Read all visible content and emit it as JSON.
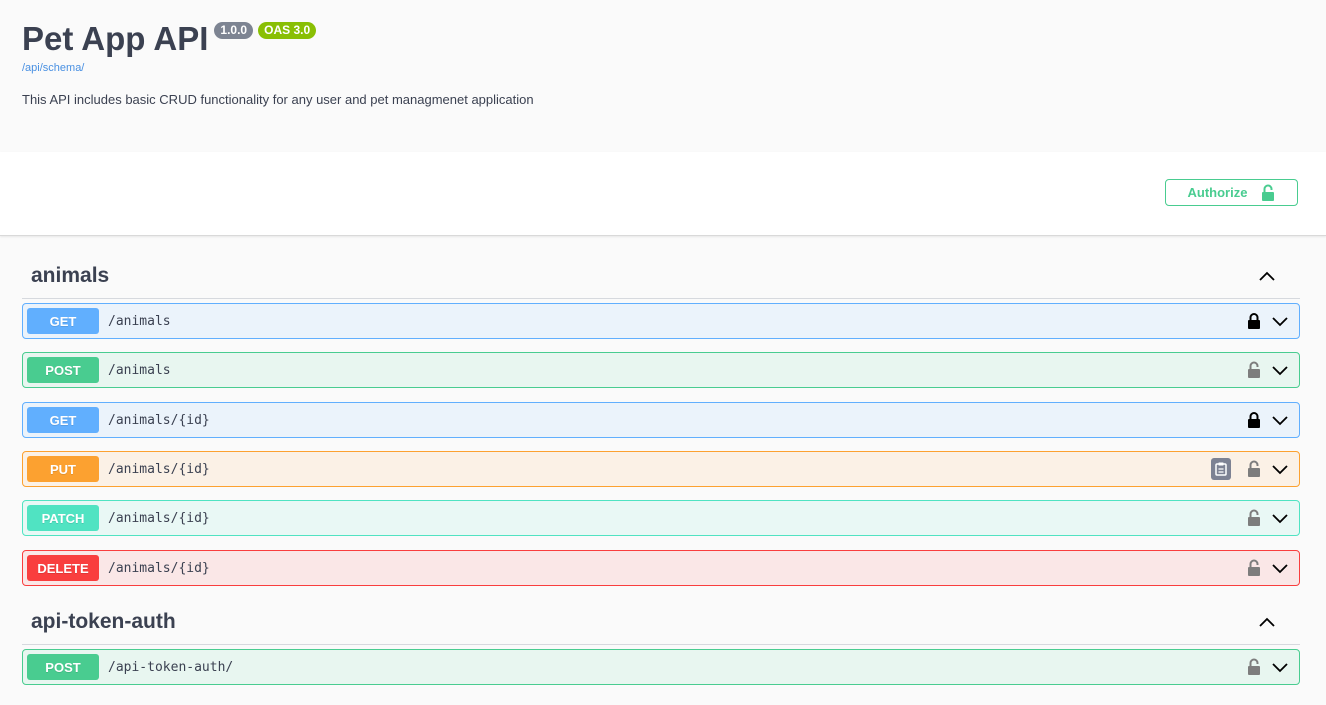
{
  "info": {
    "title": "Pet App API",
    "version": "1.0.0",
    "oas": "OAS 3.0",
    "schema_link": "/api/schema/",
    "description": "This API includes basic CRUD functionality for any user and pet managmenet application"
  },
  "authorize": {
    "label": "Authorize"
  },
  "tags": [
    {
      "name": "animals",
      "operations": [
        {
          "method": "GET",
          "path": "/animals",
          "locked": true
        },
        {
          "method": "POST",
          "path": "/animals",
          "locked": false
        },
        {
          "method": "GET",
          "path": "/animals/{id}",
          "locked": true
        },
        {
          "method": "PUT",
          "path": "/animals/{id}",
          "locked": false,
          "copy": true
        },
        {
          "method": "PATCH",
          "path": "/animals/{id}",
          "locked": false
        },
        {
          "method": "DELETE",
          "path": "/animals/{id}",
          "locked": false
        }
      ]
    },
    {
      "name": "api-token-auth",
      "operations": [
        {
          "method": "POST",
          "path": "/api-token-auth/",
          "locked": false
        }
      ]
    }
  ],
  "colors": {
    "get": "#61affe",
    "post": "#49cc90",
    "put": "#fca130",
    "patch": "#50e3c2",
    "delete": "#f93e3e",
    "lock_locked": "#000000",
    "lock_unlocked": "#7d7d7d"
  },
  "icons": [
    "lock-icon",
    "unlock-icon",
    "chevron-down-icon",
    "chevron-up-icon",
    "clipboard-icon"
  ]
}
